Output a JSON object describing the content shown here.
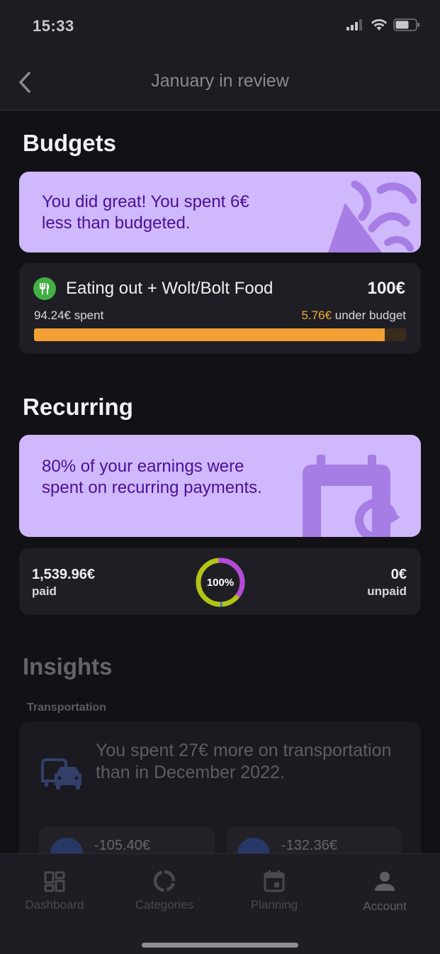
{
  "status_bar": {
    "time": "15:33"
  },
  "nav": {
    "title": "January in review"
  },
  "budgets": {
    "section_title": "Budgets",
    "promo_text": "You did great! You spent 6€ less than budgeted.",
    "item": {
      "name": "Eating out + Wolt/Bolt Food",
      "amount": "100€",
      "spent_label": "94.24€ spent",
      "under_value": "5.76€",
      "under_label": " under budget",
      "progress_fraction": 0.942
    }
  },
  "recurring": {
    "section_title": "Recurring",
    "promo_text": "80% of your earnings were spent on recurring payments.",
    "paid_value": "1,539.96€",
    "paid_label": "paid",
    "donut_label": "100%",
    "unpaid_value": "0€",
    "unpaid_label": "unpaid"
  },
  "insights": {
    "section_title": "Insights",
    "category": "Transportation",
    "text": "You spent 27€ more on transportation than in December 2022.",
    "cards": [
      {
        "value": "-105.40€"
      },
      {
        "value": "-132.36€"
      }
    ]
  },
  "tabs": [
    {
      "label": "Dashboard",
      "icon": "dashboard-icon"
    },
    {
      "label": "Categories",
      "icon": "categories-icon"
    },
    {
      "label": "Planning",
      "icon": "calendar-icon"
    },
    {
      "label": "Account",
      "icon": "account-icon"
    }
  ],
  "colors": {
    "accent_purple": "#cfb8fb",
    "promo_text": "#4a1196",
    "progress": "#f2a033",
    "under_budget": "#f2a836"
  }
}
